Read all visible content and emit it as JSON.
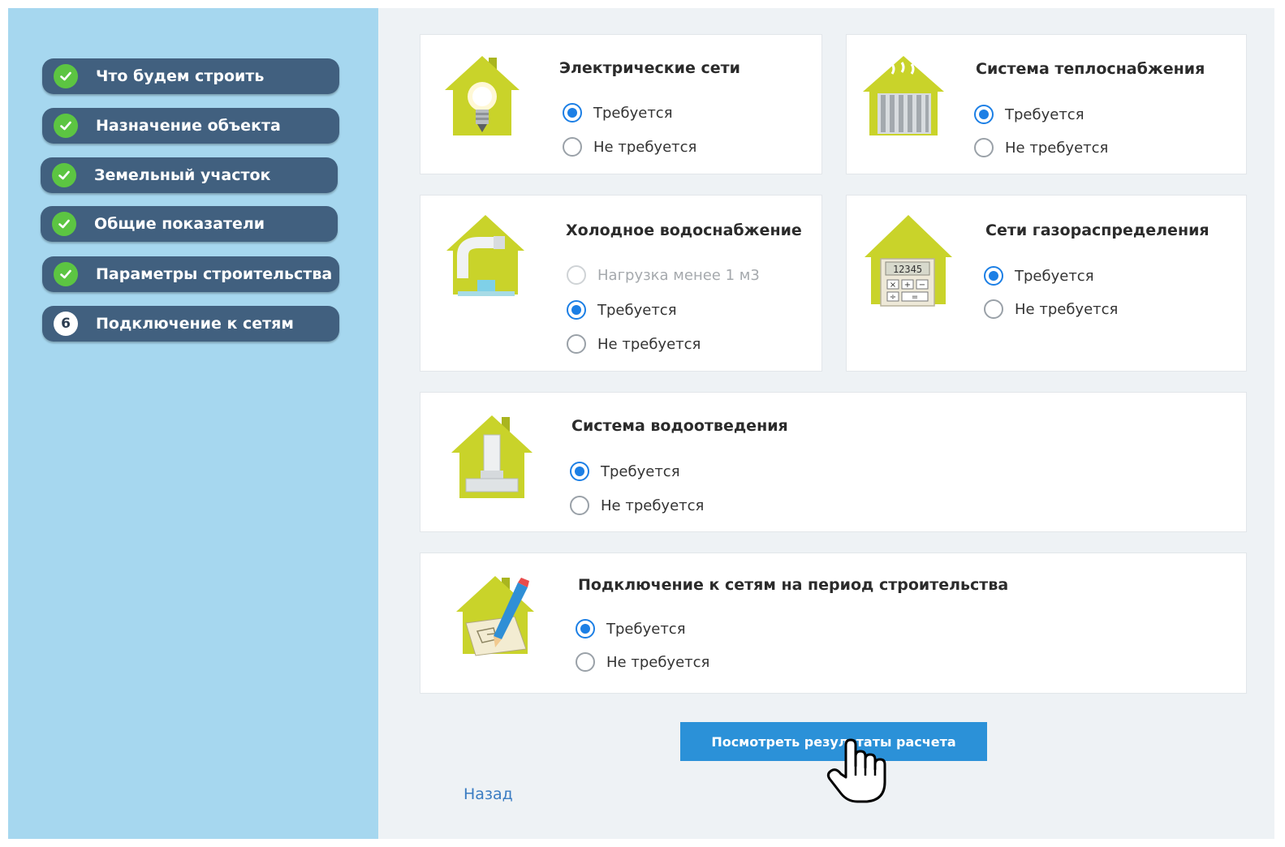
{
  "sidebar": {
    "steps": [
      {
        "label": "Что будем строить",
        "status": "done"
      },
      {
        "label": "Назначение объекта",
        "status": "done"
      },
      {
        "label": "Земельный участок",
        "status": "done"
      },
      {
        "label": "Общие показатели",
        "status": "done"
      },
      {
        "label": "Параметры строительства",
        "status": "done"
      },
      {
        "label": "Подключение к сетям",
        "status": "current",
        "number": "6"
      }
    ]
  },
  "cards": {
    "electric": {
      "title": "Электрические сети",
      "icon": "light-bulb-house-icon",
      "options": [
        "Требуется",
        "Не требуется"
      ],
      "selected": "Требуется"
    },
    "heat": {
      "title": "Система теплоснабжения",
      "icon": "radiator-house-icon",
      "options": [
        "Требуется",
        "Не требуется"
      ],
      "selected": "Требуется"
    },
    "cold_water": {
      "title": "Холодное водоснабжение",
      "icon": "water-faucet-house-icon",
      "options": [
        "Нагрузка менее 1 м3",
        "Требуется",
        "Не требуется"
      ],
      "selected": "Требуется",
      "disabled": "Нагрузка менее 1 м3"
    },
    "gas": {
      "title": "Сети газораспределения",
      "icon": "calculator-house-icon",
      "calc_display": "12345",
      "options": [
        "Требуется",
        "Не требуется"
      ],
      "selected": "Требуется"
    },
    "drainage": {
      "title": "Система водоотведения",
      "icon": "pipe-house-icon",
      "options": [
        "Требуется",
        "Не требуется"
      ],
      "selected": "Требуется"
    },
    "construction": {
      "title": "Подключение к сетям на период строительства",
      "icon": "blueprint-pencil-house-icon",
      "options": [
        "Требуется",
        "Не требуется"
      ],
      "selected": "Требуется"
    }
  },
  "actions": {
    "calculate_label": "Посмотреть результаты расчета",
    "back_label": "Назад"
  },
  "colors": {
    "sidebar_bg": "#a6d7ef",
    "step_bg": "#41607f",
    "check_green": "#5cc542",
    "radio_blue": "#1c7fe5",
    "button_blue": "#2b91d8",
    "house_yellow": "#c9d32a"
  }
}
